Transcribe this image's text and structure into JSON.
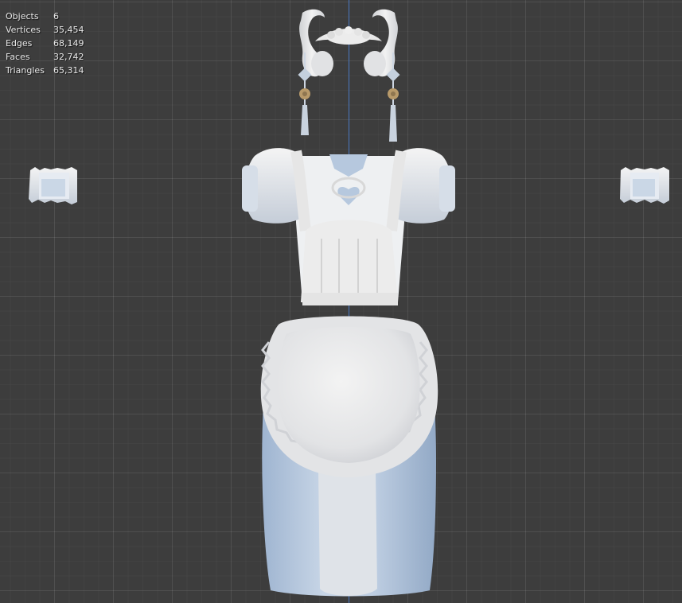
{
  "statistics": {
    "rows": [
      {
        "label": "Objects",
        "value": "6"
      },
      {
        "label": "Vertices",
        "value": "35,454"
      },
      {
        "label": "Edges",
        "value": "68,149"
      },
      {
        "label": "Faces",
        "value": "32,742"
      },
      {
        "label": "Triangles",
        "value": "65,314"
      }
    ]
  },
  "colors": {
    "background": "#3d3d3d",
    "z_axis": "#4a78c2",
    "model_light": "#eeeeee",
    "model_shadow": "#b9c6d6",
    "model_blue": "#aec3dc",
    "accent_gold": "#b89a6a"
  }
}
